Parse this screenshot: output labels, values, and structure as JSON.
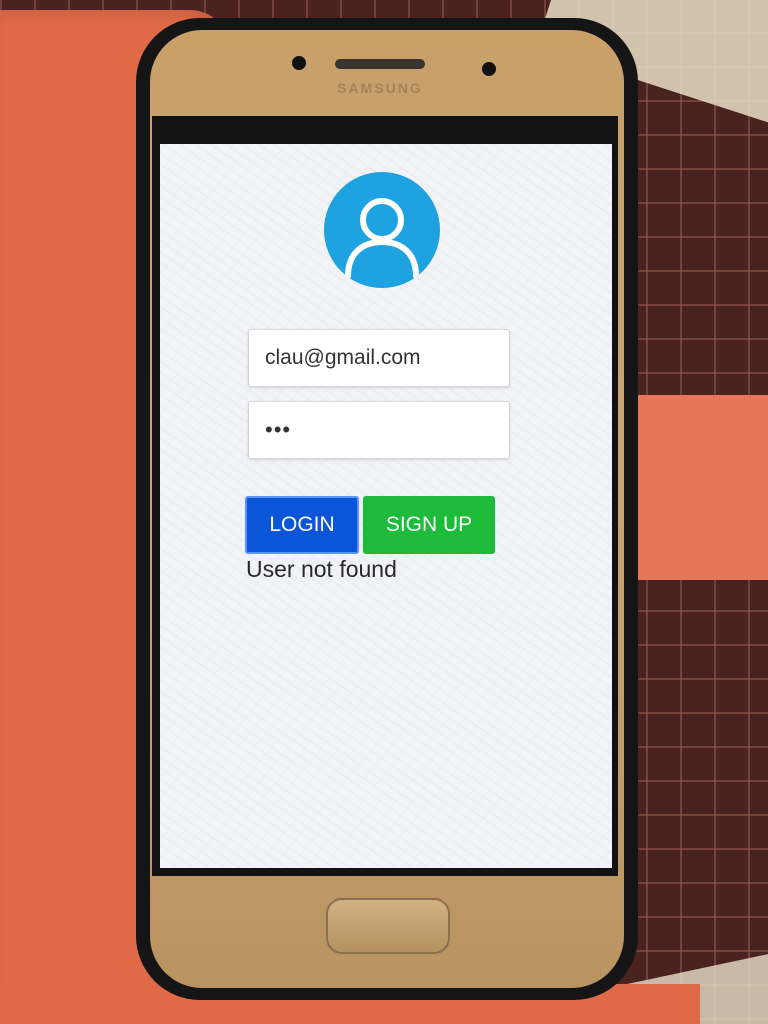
{
  "login_form": {
    "avatar_icon": "user-icon",
    "email_value": "clau@gmail.com",
    "password_value": "•••",
    "login_label": "LOGIN",
    "signup_label": "SIGN UP",
    "error_message": "User not found"
  },
  "device": {
    "brand_text": "SAMSUNG"
  },
  "colors": {
    "avatar_bg": "#1ea3e0",
    "login_button": "#0b55d8",
    "signup_button": "#1cbb3a",
    "screen_bg": "#f1f3f6",
    "phone_body": "#c8a068",
    "case": "#e06a48"
  }
}
